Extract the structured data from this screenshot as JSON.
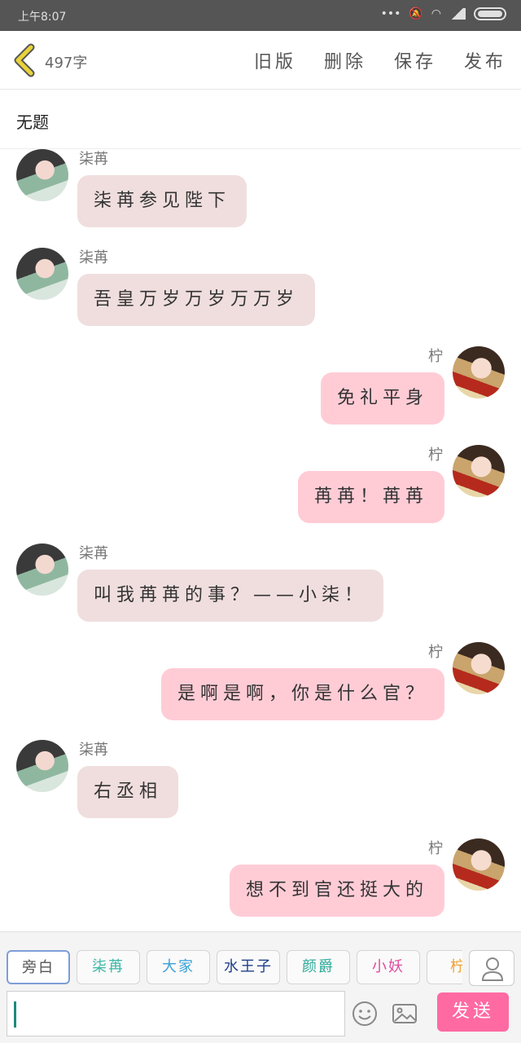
{
  "status": {
    "time": "上午8:07"
  },
  "topbar": {
    "word_count": "497字",
    "actions": [
      "旧版",
      "删除",
      "保存",
      "发布"
    ]
  },
  "title": "无题",
  "messages": [
    {
      "side": "left",
      "name": "柒苒",
      "text": "柒苒参见陛下"
    },
    {
      "side": "left",
      "name": "柒苒",
      "text": "吾皇万岁万岁万万岁"
    },
    {
      "side": "right",
      "name": "柠",
      "text": "免礼平身"
    },
    {
      "side": "right",
      "name": "柠",
      "text": "苒苒！苒苒"
    },
    {
      "side": "left",
      "name": "柒苒",
      "text": "叫我苒苒的事？——小柒！"
    },
    {
      "side": "right",
      "name": "柠",
      "text": "是啊是啊，你是什么官？"
    },
    {
      "side": "left",
      "name": "柒苒",
      "text": "右丞相"
    },
    {
      "side": "right",
      "name": "柠",
      "text": "想不到官还挺大的"
    }
  ],
  "roles": [
    {
      "label": "旁白",
      "color": "#555555",
      "active": true
    },
    {
      "label": "柒苒",
      "color": "#3cb8a8",
      "active": false
    },
    {
      "label": "大家",
      "color": "#3aa0d8",
      "active": false
    },
    {
      "label": "水王子",
      "color": "#1f3f8a",
      "active": false
    },
    {
      "label": "颜爵",
      "color": "#2eaa9a",
      "active": false
    },
    {
      "label": "小妖",
      "color": "#e04aa0",
      "active": false
    },
    {
      "label": "柠",
      "color": "#f0a030",
      "active": false
    }
  ],
  "send_label": "发送",
  "icons": {
    "back": "chevron-left-icon",
    "emoji": "smiley-icon",
    "image": "image-icon",
    "profile": "person-icon"
  },
  "colors": {
    "left_bubble": "#f0dede",
    "right_bubble": "#ffccd6",
    "send_button": "#ff6aa3",
    "back_arrow": "#e8d33a"
  }
}
